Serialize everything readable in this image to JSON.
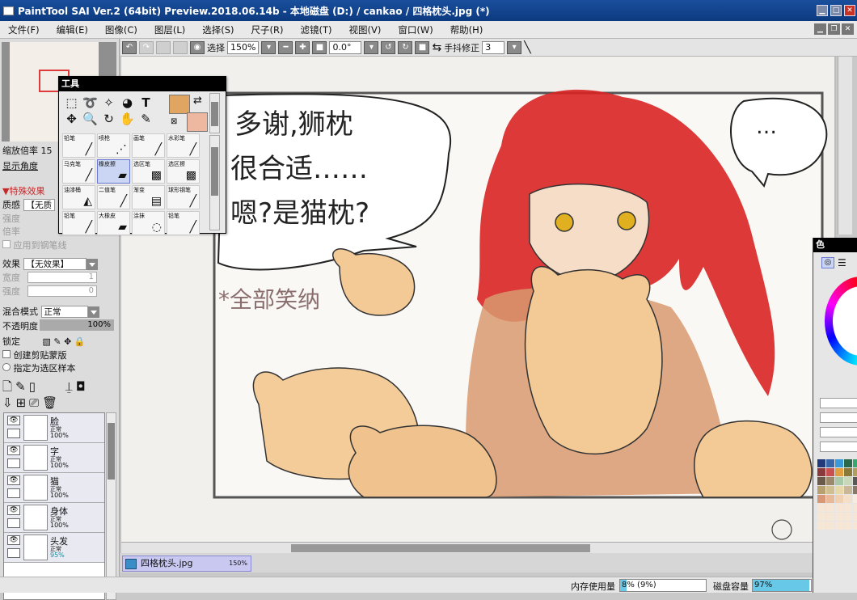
{
  "window": {
    "title": "PaintTool SAI Ver.2 (64bit) Preview.2018.06.14b - 本地磁盘 (D:) / cankao / 四格枕头.jpg (*)"
  },
  "menu": [
    "文件(F)",
    "编辑(E)",
    "图像(C)",
    "图层(L)",
    "选择(S)",
    "尺子(R)",
    "滤镜(T)",
    "视图(V)",
    "窗口(W)",
    "帮助(H)"
  ],
  "toolbar": {
    "select_label": "选择",
    "zoom": "150%",
    "angle": "0.0°",
    "stabilizer_label": "手抖修正",
    "stabilizer_value": "3"
  },
  "navigator": {
    "zoom_label": "缩放倍率",
    "zoom_value": "15",
    "angle_label": "显示角度"
  },
  "special_effects": {
    "header": "▼特殊效果",
    "texture_label": "质感",
    "texture_value": "【无质",
    "strength_label": "强度",
    "scale_label": "倍率",
    "apply_to_pen": "应用到钢笔线"
  },
  "effect": {
    "label": "效果",
    "value": "【无效果】",
    "width_label": "宽度",
    "width_value": "1",
    "strength_label": "强度",
    "strength_value": "0"
  },
  "blend": {
    "label": "混合模式",
    "value": "正常",
    "opacity_label": "不透明度",
    "opacity_value": "100%",
    "lock_label": "锁定",
    "clipping": "创建剪贴蒙版",
    "selection_source": "指定为选区样本"
  },
  "layers": [
    {
      "name": "脸",
      "mode": "正常",
      "opacity": "100%"
    },
    {
      "name": "字",
      "mode": "正常",
      "opacity": "100%"
    },
    {
      "name": "猫",
      "mode": "正常",
      "opacity": "100%"
    },
    {
      "name": "身体",
      "mode": "正常",
      "opacity": "100%"
    },
    {
      "name": "头发",
      "mode": "正常",
      "opacity": "95%"
    }
  ],
  "tools_window": {
    "title": "工具",
    "brushes": [
      {
        "label": "铅笔",
        "icon": "pencil"
      },
      {
        "label": "喷枪",
        "icon": "airbrush"
      },
      {
        "label": "画笔",
        "icon": "brush"
      },
      {
        "label": "水彩笔",
        "icon": "watercolor"
      },
      {
        "label": "马克笔",
        "icon": "marker"
      },
      {
        "label": "橡皮擦",
        "icon": "eraser"
      },
      {
        "label": "选区笔",
        "icon": "selpen"
      },
      {
        "label": "选区擦",
        "icon": "selerase"
      },
      {
        "label": "油漆桶",
        "icon": "bucket"
      },
      {
        "label": "二值笔",
        "icon": "binary"
      },
      {
        "label": "渐变",
        "icon": "gradient"
      },
      {
        "label": "球形钢笔",
        "icon": "ballpen"
      },
      {
        "label": "铅笔",
        "icon": "pencil2"
      },
      {
        "label": "大橡皮",
        "icon": "bigeraser"
      },
      {
        "label": "涂抹",
        "icon": "blur"
      },
      {
        "label": "铅笔",
        "icon": "pencil3"
      }
    ],
    "primary_color": "#e0a560",
    "secondary_color": "#eeb8a0"
  },
  "artwork": {
    "bubble1_lines": [
      "多谢,狮枕",
      "很合适……",
      "嗯?是猫枕?"
    ],
    "bubble2": "…",
    "caption": "*全部笑纳"
  },
  "document_tab": {
    "name": "四格枕头.jpg",
    "zoom": "150%"
  },
  "status": {
    "memory_label": "内存使用量",
    "memory_value": "8% (9%)",
    "memory_fraction": 0.08,
    "disk_label": "磁盘容量",
    "disk_value": "97%",
    "disk_fraction": 0.97
  },
  "color_window": {
    "title": "色"
  }
}
